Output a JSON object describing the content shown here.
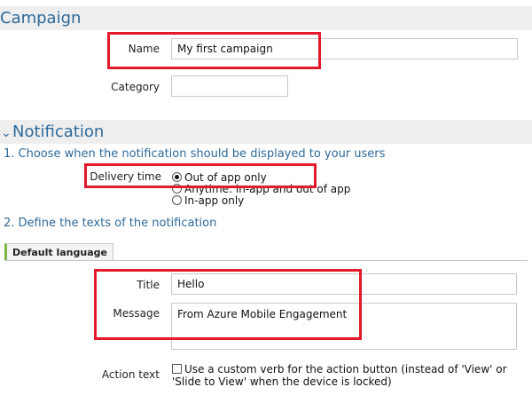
{
  "campaign": {
    "header": "Campaign",
    "name_label": "Name",
    "name_value": "My first campaign",
    "category_label": "Category",
    "category_value": ""
  },
  "notification": {
    "header": "Notification",
    "step1": "1. Choose when the notification should be displayed to your users",
    "delivery_label": "Delivery time",
    "delivery_options": [
      {
        "label": "Out of app only",
        "selected": true
      },
      {
        "label": "Anytime: in-app and out of app",
        "selected": false
      },
      {
        "label": "In-app only",
        "selected": false
      }
    ],
    "step2": "2. Define the texts of the notification",
    "tab_label": "Default language",
    "title_label": "Title",
    "title_value": "Hello",
    "message_label": "Message",
    "message_value": "From Azure Mobile Engagement",
    "action_label": "Action text",
    "action_checkbox_text": "Use a custom verb for the action button (instead of 'View' or 'Slide to View' when the device is locked)"
  },
  "colors": {
    "highlight": "#e21a2c",
    "header_text": "#2e6a9a",
    "header_bg": "#eeeeee",
    "tab_accent": "#7ab648"
  }
}
